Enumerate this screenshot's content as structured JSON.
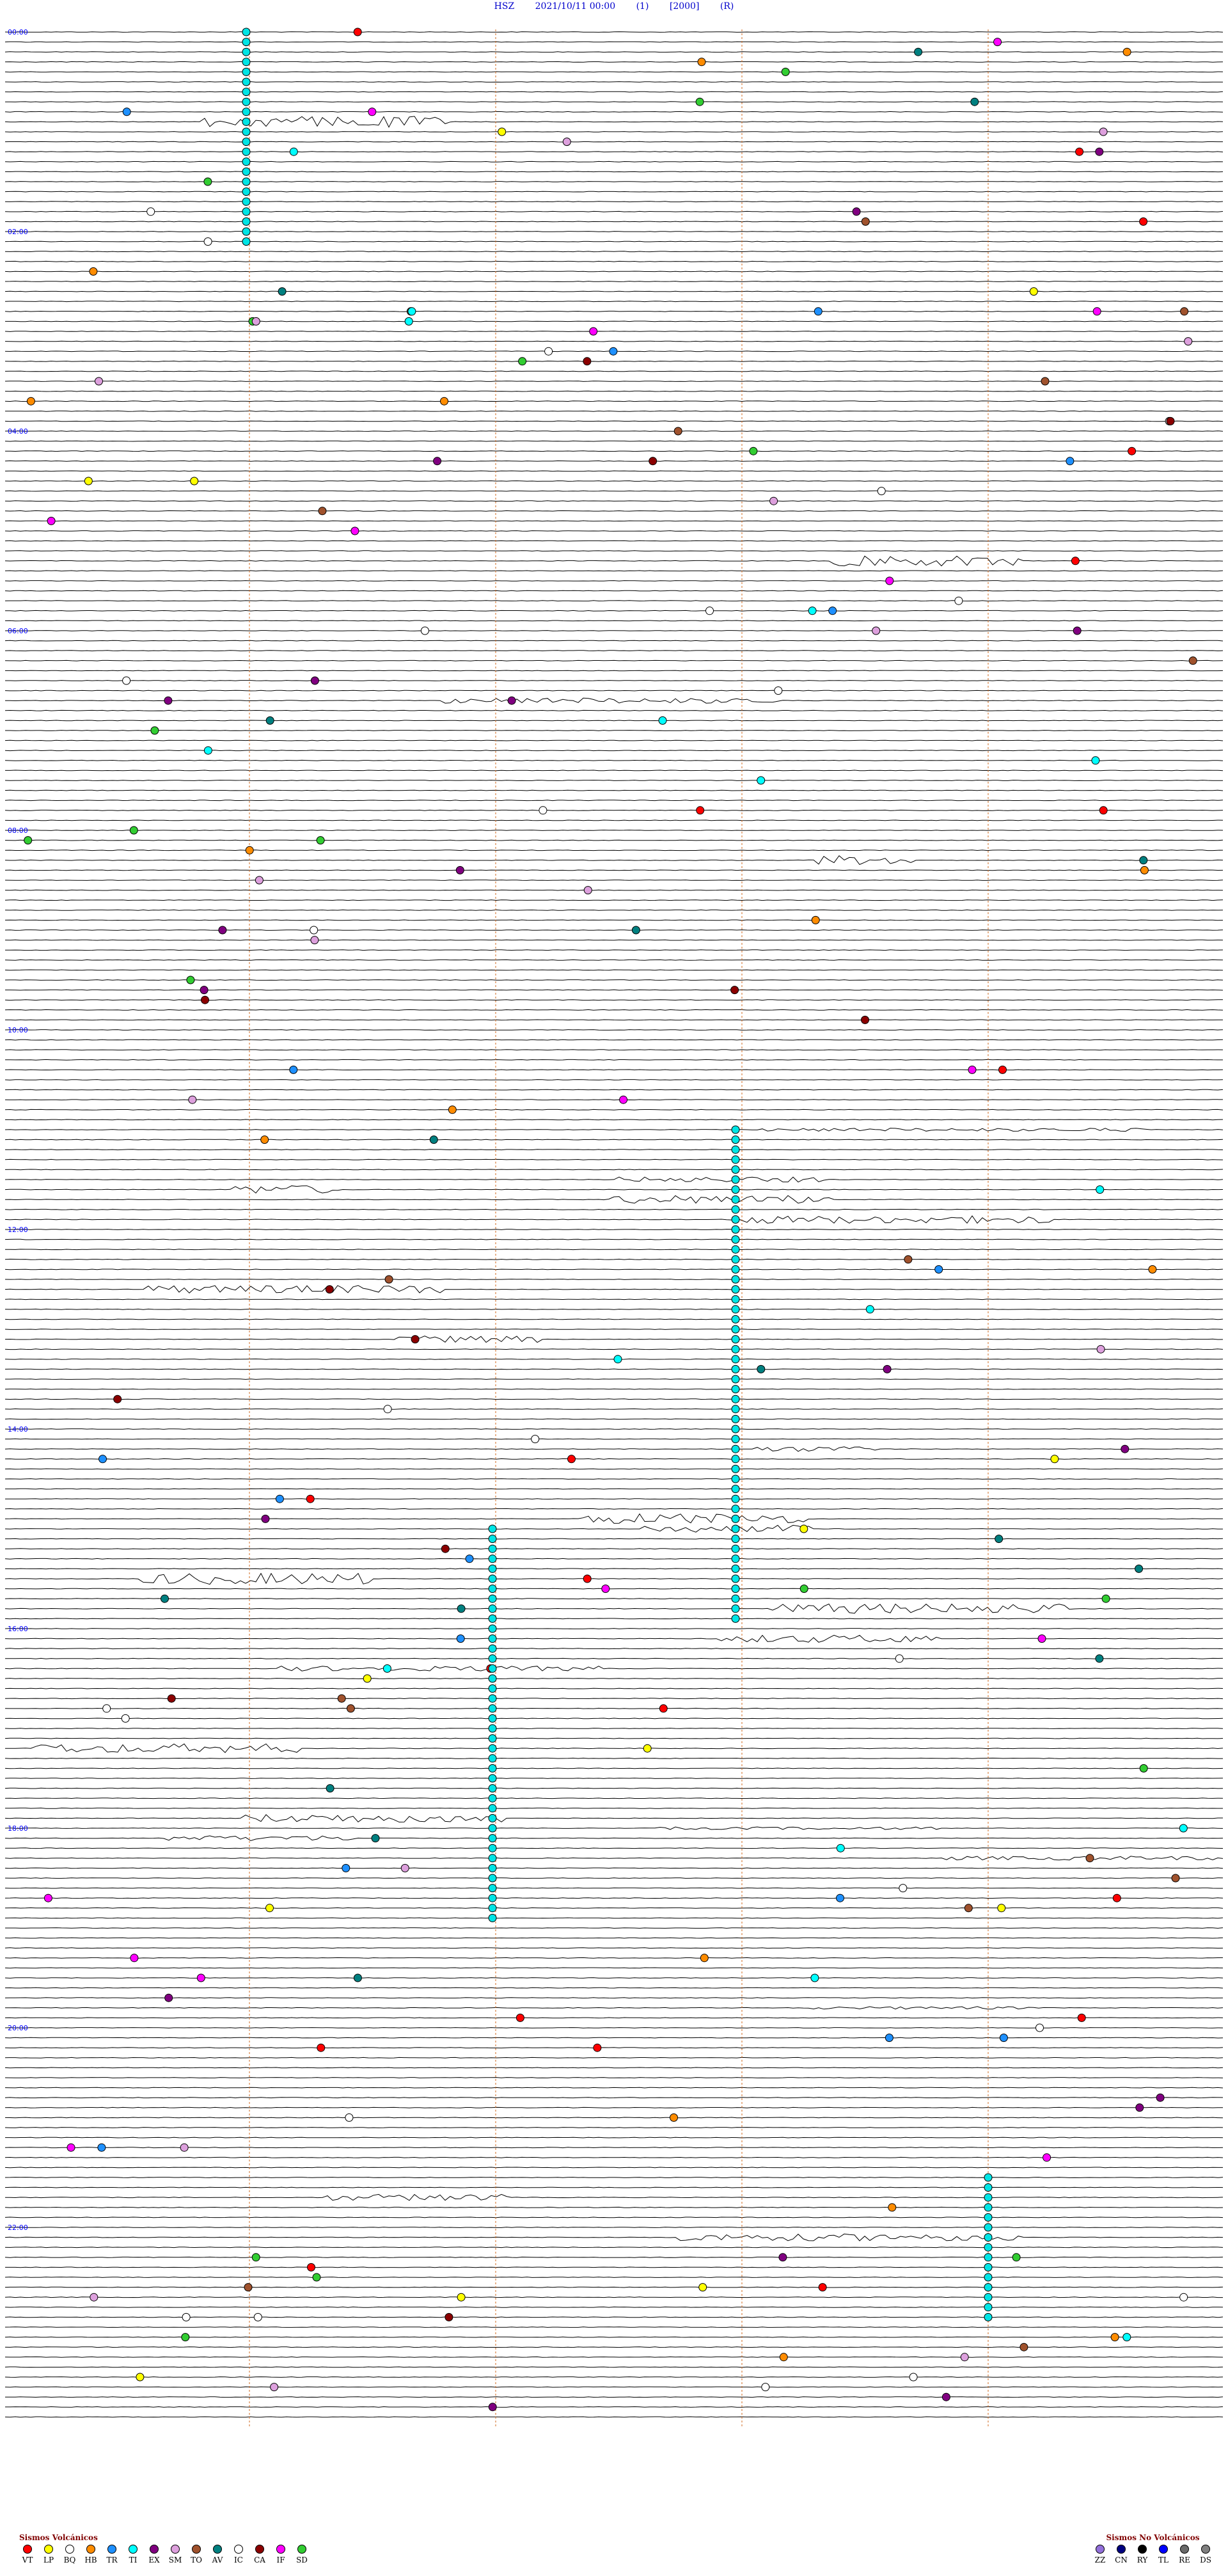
{
  "header": {
    "station": "HSZ",
    "datetime": "2021/10/11 00:00",
    "filter": "(1)",
    "scale": "[2000]",
    "mode": "(R)"
  },
  "colors": {
    "trace": "#000000",
    "hour_label": "#0000ff",
    "minute_marker": "#d2691e",
    "event_marker": "#00e5e5"
  },
  "chart_data": {
    "type": "seismogram",
    "station": "HSZ",
    "start": "2021/10/11 00:00",
    "hour_labels": [
      "00:00",
      "02:00",
      "04:00",
      "06:00",
      "08:00",
      "10:00",
      "12:00",
      "14:00",
      "16:00",
      "18:00",
      "20:00",
      "22:00"
    ],
    "legend_volcanic": {
      "title": "Sismos Volcánicos",
      "items": [
        {
          "code": "VT",
          "color": "#ff0000"
        },
        {
          "code": "LP",
          "color": "#ffff00"
        },
        {
          "code": "BQ",
          "color": "#ffffff"
        },
        {
          "code": "HB",
          "color": "#ff8c00"
        },
        {
          "code": "TR",
          "color": "#1e90ff"
        },
        {
          "code": "TI",
          "color": "#00ffff"
        },
        {
          "code": "EX",
          "color": "#800080"
        },
        {
          "code": "SM",
          "color": "#dda0dd"
        },
        {
          "code": "TO",
          "color": "#a0522d"
        },
        {
          "code": "AV",
          "color": "#008080"
        },
        {
          "code": "IC",
          "color": "#ffffff"
        },
        {
          "code": "CA",
          "color": "#8b0000"
        },
        {
          "code": "IF",
          "color": "#ff00ff"
        },
        {
          "code": "SD",
          "color": "#32cd32"
        }
      ]
    },
    "legend_nonvolcanic": {
      "title": "Sismos No Volcánicos",
      "items": [
        {
          "code": "ZZ",
          "color": "#9370db"
        },
        {
          "code": "CN",
          "color": "#000080"
        },
        {
          "code": "RY",
          "color": "#000000"
        },
        {
          "code": "TL",
          "color": "#0000ff"
        },
        {
          "code": "RE",
          "color": "#696969"
        },
        {
          "code": "DS",
          "color": "#808080"
        }
      ]
    }
  }
}
